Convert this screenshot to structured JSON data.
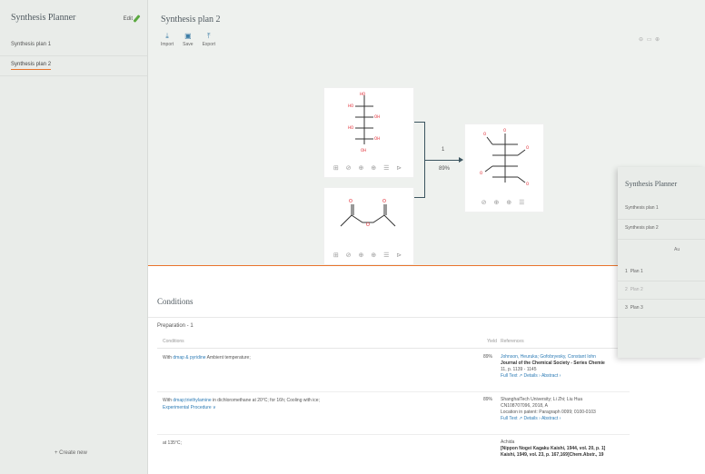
{
  "sidebar": {
    "title": "Synthesis Planner",
    "edit_label": "Edit",
    "plans": [
      {
        "label": "Synthesis plan 1"
      },
      {
        "label": "Synthesis plan 2"
      }
    ],
    "create_label": "+ Create new"
  },
  "header": {
    "plan_title": "Synthesis plan 2",
    "toolbar": [
      {
        "label": "Import",
        "icon": "import-icon"
      },
      {
        "label": "Save",
        "icon": "save-icon"
      },
      {
        "label": "Export",
        "icon": "export-icon"
      }
    ]
  },
  "reaction": {
    "step": "1",
    "yield": "89%",
    "reactant_tools": "⊞ ⊘ ⊕ ⊕ ☰ ⊳",
    "product_tools": "⊘ ⊕ ⊕ ☰"
  },
  "conditions": {
    "title": "Conditions",
    "preparation": "Preparation - 1",
    "headers": {
      "conditions": "Conditions",
      "yield": "Yield",
      "references": "References"
    },
    "rows": [
      {
        "cond_prefix": "With ",
        "cond_links": "dmap & pyridine",
        "cond_rest": " Ambient temperature;",
        "cond_extra": "",
        "yield": "89%",
        "ref_authors": "Johnson, Heuruka; Gofobryesky, Constant Iohn",
        "ref_journal": "Journal of the Chemical Society - Series Chemie",
        "ref_detail": "11, p. 1139 - 1145",
        "ref_links": "Full Text ↗   Details ›   Abstract ›"
      },
      {
        "cond_prefix": "With ",
        "cond_links": "dmap;triethylamine",
        "cond_rest": " in dichloromethane at 20°C; for 16h; Cooling with ice;",
        "cond_extra": "Experimental Procedure ∨",
        "yield": "89%",
        "ref_authors": "ShanghaiTech University; Li Zhi; Liu Hua",
        "ref_journal": "CN108707096, 2018, A",
        "ref_detail": "Location in patent: Paragraph 0099; 0100-0103",
        "ref_links": "Full Text ↗   Details ›   Abstract ›"
      },
      {
        "cond_prefix": "",
        "cond_links": "",
        "cond_rest": "at 135°C;",
        "cond_extra": "",
        "yield": "",
        "ref_authors": "Achida",
        "ref_journal": "[Nippon Nogei Kagaku Kaishi, 1944, vol. 20, p. 1]",
        "ref_detail": "Kaishi, 1949, vol. 23, p. 167,169]Chem.Abstr., 19",
        "ref_links": ""
      }
    ]
  },
  "overlay": {
    "title": "Synthesis Planner",
    "plans": [
      {
        "label": "Synthesis plan 1"
      },
      {
        "label": "Synthesis plan 2"
      }
    ],
    "au_label": "Au",
    "sub_plans": [
      {
        "label": "Plan 1",
        "num": "1"
      },
      {
        "label": "Plan 2",
        "num": "2"
      },
      {
        "label": "Plan 3",
        "num": "3"
      }
    ]
  },
  "colors": {
    "accent": "#e8742c",
    "link": "#2c7bb5",
    "oxygen": "#e0262f",
    "bond": "#333333"
  }
}
